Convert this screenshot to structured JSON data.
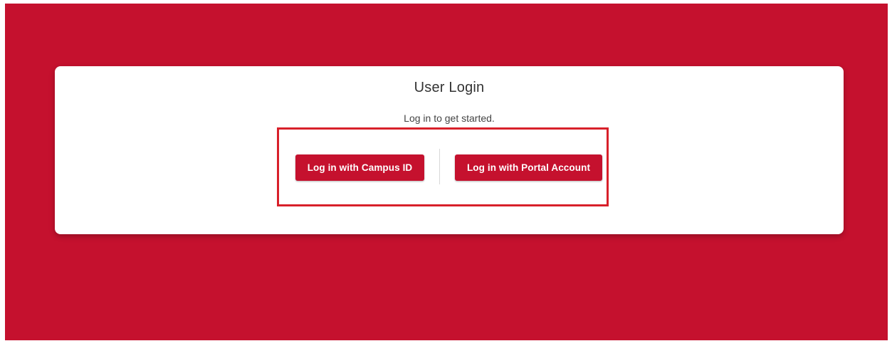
{
  "login": {
    "title": "User Login",
    "subtitle": "Log in to get started.",
    "campus_button": "Log in with Campus ID",
    "portal_button": "Log in with Portal Account"
  },
  "colors": {
    "background": "#c5112e",
    "card": "#ffffff",
    "button": "#c5112e",
    "highlight_border": "#d8202a"
  }
}
